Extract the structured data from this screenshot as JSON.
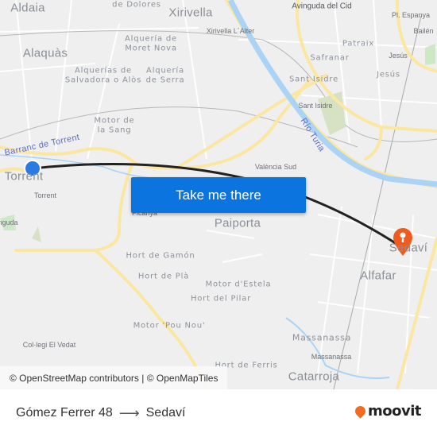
{
  "map": {
    "labels": {
      "aldaia": "Aldaia",
      "de_dolores": "de Dolores",
      "xirivella": "Xirivella",
      "avinguda_cid": "Avinguda del Cid",
      "pl_espanya": "Pl. Espanya",
      "ballen": "Bailén",
      "xirivella_alter": "Xirivella L´Alter",
      "patraix": "Patraix",
      "safranar": "Safranar",
      "jesus_station": "Jesús",
      "jesus": "Jesús",
      "alaquas": "Alaquàs",
      "alqueria_moret_1": "Alquería de",
      "alqueria_moret_2": "Moret Nova",
      "alquerias_salvadora_1": "Alquerías de",
      "alquerias_salvadora_2": "Salvadora o Alòs",
      "alqueria_serra_1": "Alquería",
      "alqueria_serra_2": "de Serra",
      "sant_isidre": "Sant Isidre",
      "sant_isidre_station": "Sant Isidre",
      "motor_sang_1": "Motor de",
      "motor_sang_2": "la Sang",
      "barranc": "Barranc de Torrent",
      "rio_turia": "Río Turia",
      "valencia_sud": "València Sud",
      "torrent": "Torrent",
      "torrent_station": "Torrent",
      "picanya": "Picanya",
      "paiporta": "Paiporta",
      "sedavi": "Sedaví",
      "alfafar": "Alfafar",
      "nguda": "nguda",
      "hort_gamon": "Hort de Gamón",
      "hort_pla": "Hort de Plà",
      "motor_estela": "Motor d'Estela",
      "hort_pilar": "Hort del Pilar",
      "motor_pou_nou": "Motor 'Pou Nou'",
      "collegi_vedat": "Col·legi El Vedat",
      "massanassa": "Massanassa",
      "massanassa_station": "Massanassa",
      "hort_ferris": "Hort de Ferris",
      "catarroja": "Catarroja"
    },
    "colors": {
      "route": "#222222",
      "origin": "#2a7ae4",
      "destination": "#f25a1d",
      "road": "#fbe7a1",
      "river": "#aad3f5",
      "background": "#efefef"
    },
    "cta_label": "Take me there",
    "attribution": "© OpenStreetMap contributors | © OpenMapTiles"
  },
  "footer": {
    "origin": "Gómez Ferrer 48",
    "arrow_icon": "arrow-right-icon",
    "destination": "Sedaví",
    "brand": "moovit"
  }
}
